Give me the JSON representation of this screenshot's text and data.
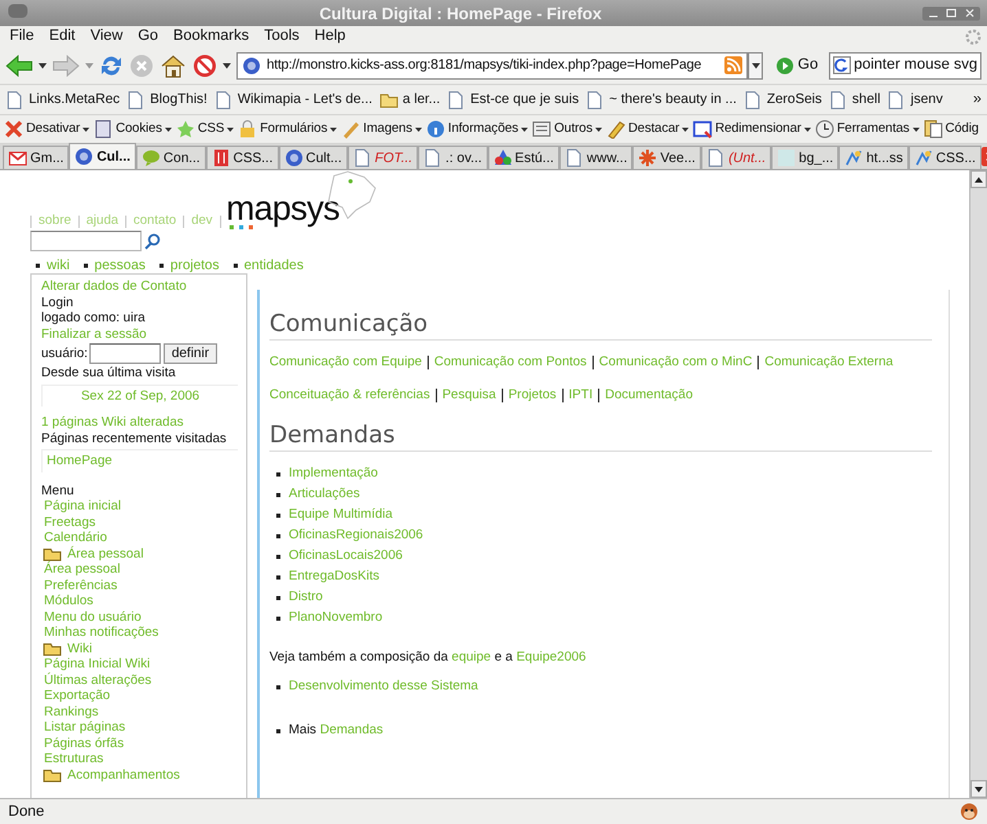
{
  "window": {
    "title": "Cultura Digital : HomePage - Firefox"
  },
  "menu": [
    "File",
    "Edit",
    "View",
    "Go",
    "Bookmarks",
    "Tools",
    "Help"
  ],
  "nav_toolbar": {
    "url": "http://monstro.kicks-ass.org:8181/mapsys/tiki-index.php?page=HomePage",
    "go_label": "Go",
    "search_value": "pointer mouse svg"
  },
  "bookmarks": [
    {
      "label": "Links.MetaRec",
      "kind": "page"
    },
    {
      "label": "BlogThis!",
      "kind": "page"
    },
    {
      "label": "Wikimapia - Let's de...",
      "kind": "page"
    },
    {
      "label": "a ler...",
      "kind": "folder"
    },
    {
      "label": "Est-ce que je suis",
      "kind": "page"
    },
    {
      "label": "~ there's beauty in ...",
      "kind": "page"
    },
    {
      "label": "ZeroSeis",
      "kind": "page"
    },
    {
      "label": "shell",
      "kind": "page"
    },
    {
      "label": "jsenv",
      "kind": "page"
    }
  ],
  "bookmarks_overflow": "»",
  "devtools": [
    "Desativar",
    "Cookies",
    "CSS",
    "Formulários",
    "Imagens",
    "Informações",
    "Outros",
    "Destacar",
    "Redimensionar",
    "Ferramentas",
    "Códig"
  ],
  "tabs": [
    {
      "label": "Gm...",
      "selected": false,
      "kind": "normal"
    },
    {
      "label": "Cul...",
      "selected": true,
      "kind": "normal"
    },
    {
      "label": "Con...",
      "selected": false,
      "kind": "normal"
    },
    {
      "label": "CSS...",
      "selected": false,
      "kind": "normal"
    },
    {
      "label": "Cult...",
      "selected": false,
      "kind": "normal"
    },
    {
      "label": "FOT...",
      "selected": false,
      "kind": "error"
    },
    {
      "label": ".: ov...",
      "selected": false,
      "kind": "normal"
    },
    {
      "label": "Estú...",
      "selected": false,
      "kind": "normal"
    },
    {
      "label": "www...",
      "selected": false,
      "kind": "normal"
    },
    {
      "label": "Vee...",
      "selected": false,
      "kind": "normal"
    },
    {
      "label": "(Unt...",
      "selected": false,
      "kind": "error"
    },
    {
      "label": "bg_...",
      "selected": false,
      "kind": "normal"
    },
    {
      "label": "ht...ss",
      "selected": false,
      "kind": "normal"
    },
    {
      "label": "CSS...",
      "selected": false,
      "kind": "normal"
    }
  ],
  "page": {
    "top_links": [
      "sobre",
      "ajuda",
      "contato",
      "dev"
    ],
    "logo": "mapsys",
    "nav_list": [
      "wiki",
      "pessoas",
      "projetos",
      "entidades"
    ],
    "sidebar": {
      "contact_link": "Alterar dados de Contato",
      "login_title": "Login",
      "logged_as": "logado como: uira",
      "logout_link": "Finalizar a sessão",
      "user_label": "usuário:",
      "set_button": "definir",
      "since_label": "Desde sua última visita",
      "since_date": "Sex 22 of Sep, 2006",
      "changed_link": "1 páginas Wiki alteradas",
      "recent_label": "Páginas recentemente visitadas",
      "recent": [
        "HomePage"
      ],
      "menu_title": "Menu",
      "menu": [
        {
          "label": "Página inicial",
          "kind": "link"
        },
        {
          "label": "Freetags",
          "kind": "link"
        },
        {
          "label": "Calendário",
          "kind": "link"
        },
        {
          "label": "Área pessoal",
          "kind": "folder"
        },
        {
          "label": "Área pessoal",
          "kind": "link"
        },
        {
          "label": "Preferências",
          "kind": "link"
        },
        {
          "label": "Módulos",
          "kind": "link"
        },
        {
          "label": "Menu do usuário",
          "kind": "link"
        },
        {
          "label": "Minhas notificações",
          "kind": "link"
        },
        {
          "label": "Wiki",
          "kind": "folder"
        },
        {
          "label": "Página Inicial Wiki",
          "kind": "link"
        },
        {
          "label": "Últimas alterações",
          "kind": "link"
        },
        {
          "label": "Exportação",
          "kind": "link"
        },
        {
          "label": "Rankings",
          "kind": "link"
        },
        {
          "label": "Listar páginas",
          "kind": "link"
        },
        {
          "label": "Páginas órfãs",
          "kind": "link"
        },
        {
          "label": "Estruturas",
          "kind": "link"
        },
        {
          "label": "Acompanhamentos",
          "kind": "folder"
        }
      ]
    },
    "main": {
      "sections": [
        {
          "heading": "Comunicação",
          "link_rows": [
            [
              "Comunicação com Equipe",
              "Comunicação com Pontos",
              "Comunicação com o MinC",
              "Comunicação Externa"
            ],
            [
              "Conceituação & referências",
              "Pesquisa",
              "Projetos",
              "IPTI",
              "Documentação"
            ]
          ]
        },
        {
          "heading": "Demandas",
          "list": [
            "Implementação",
            "Articulações",
            "Equipe Multimídia",
            "OficinasRegionais2006",
            "OficinasLocais2006",
            "EntregaDosKits",
            "Distro",
            "PlanoNovembro"
          ],
          "see_also": {
            "before": "Veja também a composição da",
            "link_1": "equipe",
            "middle": "e a",
            "link_2": "Equipe2006"
          },
          "list2": [
            "Desenvolvimento desse Sistema"
          ],
          "more": {
            "text": "Mais",
            "link": "Demandas"
          }
        }
      ]
    }
  },
  "status_bar": {
    "text": "Done"
  }
}
